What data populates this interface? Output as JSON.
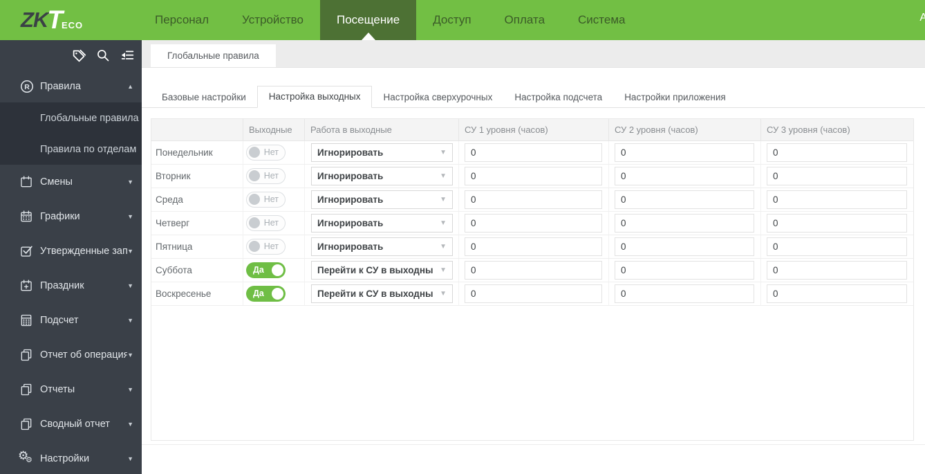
{
  "brand": {
    "zk": "ZK",
    "t": "T",
    "eco": "ECO"
  },
  "navbar": {
    "items": [
      {
        "label": "Персонал",
        "active": false
      },
      {
        "label": "Устройство",
        "active": false
      },
      {
        "label": "Посещение",
        "active": true
      },
      {
        "label": "Доступ",
        "active": false
      },
      {
        "label": "Оплата",
        "active": false
      },
      {
        "label": "Система",
        "active": false
      }
    ],
    "user_partial": "A"
  },
  "sidebar": {
    "tools": [
      {
        "icon": "tag-icon"
      },
      {
        "icon": "search-icon"
      },
      {
        "icon": "collapse-menu-icon"
      }
    ],
    "sections": [
      {
        "label": "Правила",
        "icon": "registered-icon",
        "expanded": true,
        "children": [
          "Глобальные правила",
          "Правила по отделам"
        ]
      },
      {
        "label": "Смены",
        "icon": "calendar-icon",
        "expanded": false
      },
      {
        "label": "Графики",
        "icon": "calendar-grid-icon",
        "expanded": false
      },
      {
        "label": "Утвержденные зап...",
        "icon": "checkbox-icon",
        "expanded": false
      },
      {
        "label": "Праздник",
        "icon": "calendar-plus-icon",
        "expanded": false
      },
      {
        "label": "Подсчет",
        "icon": "calculator-icon",
        "expanded": false
      },
      {
        "label": "Отчет об операциях",
        "icon": "report-icon",
        "expanded": false
      },
      {
        "label": "Отчеты",
        "icon": "report-icon",
        "expanded": false
      },
      {
        "label": "Сводный отчет",
        "icon": "report-icon",
        "expanded": false
      },
      {
        "label": "Настройки",
        "icon": "gears-icon",
        "expanded": false
      }
    ]
  },
  "main": {
    "window_tabs": [
      {
        "label": "Глобальные правила",
        "active": true
      }
    ],
    "sub_tabs": [
      {
        "label": "Базовые настройки",
        "active": false
      },
      {
        "label": "Настройка выходных",
        "active": true
      },
      {
        "label": "Настройка сверхурочных",
        "active": false
      },
      {
        "label": "Настройка подсчета",
        "active": false
      },
      {
        "label": "Настройки приложения",
        "active": false
      }
    ],
    "table": {
      "columns": [
        "",
        "Выходные",
        "Работа в выходные",
        "СУ 1 уровня (часов)",
        "СУ 2 уровня (часов)",
        "СУ 3 уровня (часов)"
      ],
      "rows": [
        {
          "day": "Понедельник",
          "weekend": false,
          "toggle_label": "Нет",
          "work_mode": "Игнорировать",
          "su1": "0",
          "su2": "0",
          "su3": "0"
        },
        {
          "day": "Вторник",
          "weekend": false,
          "toggle_label": "Нет",
          "work_mode": "Игнорировать",
          "su1": "0",
          "su2": "0",
          "su3": "0"
        },
        {
          "day": "Среда",
          "weekend": false,
          "toggle_label": "Нет",
          "work_mode": "Игнорировать",
          "su1": "0",
          "su2": "0",
          "su3": "0"
        },
        {
          "day": "Четверг",
          "weekend": false,
          "toggle_label": "Нет",
          "work_mode": "Игнорировать",
          "su1": "0",
          "su2": "0",
          "su3": "0"
        },
        {
          "day": "Пятница",
          "weekend": false,
          "toggle_label": "Нет",
          "work_mode": "Игнорировать",
          "su1": "0",
          "su2": "0",
          "su3": "0"
        },
        {
          "day": "Суббота",
          "weekend": true,
          "toggle_label": "Да",
          "work_mode": "Перейти к СУ в выходны",
          "su1": "0",
          "su2": "0",
          "su3": "0"
        },
        {
          "day": "Воскресенье",
          "weekend": true,
          "toggle_label": "Да",
          "work_mode": "Перейти к СУ в выходны",
          "su1": "0",
          "su2": "0",
          "su3": "0"
        }
      ]
    }
  },
  "colors": {
    "topbar_green": "#72bf44",
    "nav_active_green": "#4d7134",
    "sidebar_bg": "#3a4048",
    "submenu_bg": "#2d323a",
    "toggle_on_green": "#6fbe45",
    "table_header_bg": "#f4f4f4"
  }
}
